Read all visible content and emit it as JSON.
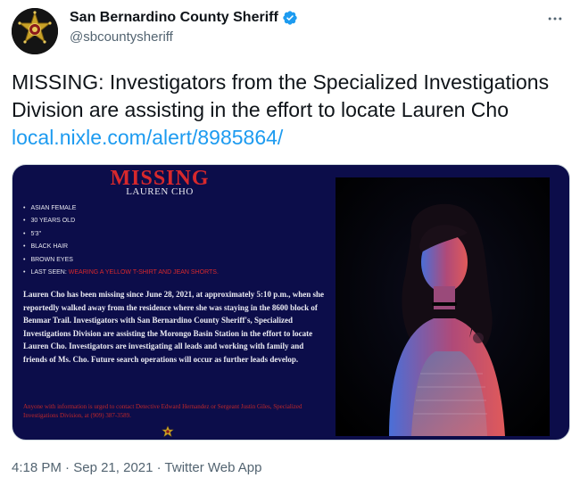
{
  "header": {
    "display_name": "San Bernardino County Sheriff",
    "handle": "@sbcountysheriff",
    "more_icon": "more-horizontal-icon",
    "verified_icon": "verified-badge-icon",
    "verified_color": "#1d9bf0"
  },
  "tweet": {
    "text": "MISSING: Investigators from the Specialized Investigations Division are assisting in the effort to locate Lauren Cho ",
    "link": "local.nixle.com/alert/8985864/",
    "link_color": "#1d9bf0"
  },
  "poster": {
    "title": "MISSING",
    "subtitle": "LAUREN CHO",
    "facts": [
      "ASIAN FEMALE",
      "30 YEARS OLD",
      "5'3\"",
      "BLACK HAIR",
      "BROWN EYES"
    ],
    "last_seen_label": "LAST SEEN:",
    "last_seen_value": "WEARING A YELLOW T-SHIRT AND JEAN SHORTS.",
    "description": "Lauren Cho has been missing since June 28, 2021, at approximately 5:10 p.m., when she reportedly walked away from the residence where she was staying in the 8600 block of Benmar Trail. Investigators with San Bernardino County Sheriff's, Specialized Investigations Division are assisting the Morongo Basin Station in the effort to locate Lauren Cho. Investigators are investigating all leads and working with family and friends of Ms. Cho. Future search operations will occur as further leads develop.",
    "contact": "Anyone with information is urged to contact Detective Edward Hernandez or Sergeant Justin Giles, Specialized Investigations Division, at (909) 387-3589.",
    "background_color": "#0c0d4a",
    "accent_color": "#d8282c"
  },
  "footer": {
    "time": "4:18 PM",
    "separator": " · ",
    "date": "Sep 21, 2021",
    "source": "Twitter Web App"
  }
}
